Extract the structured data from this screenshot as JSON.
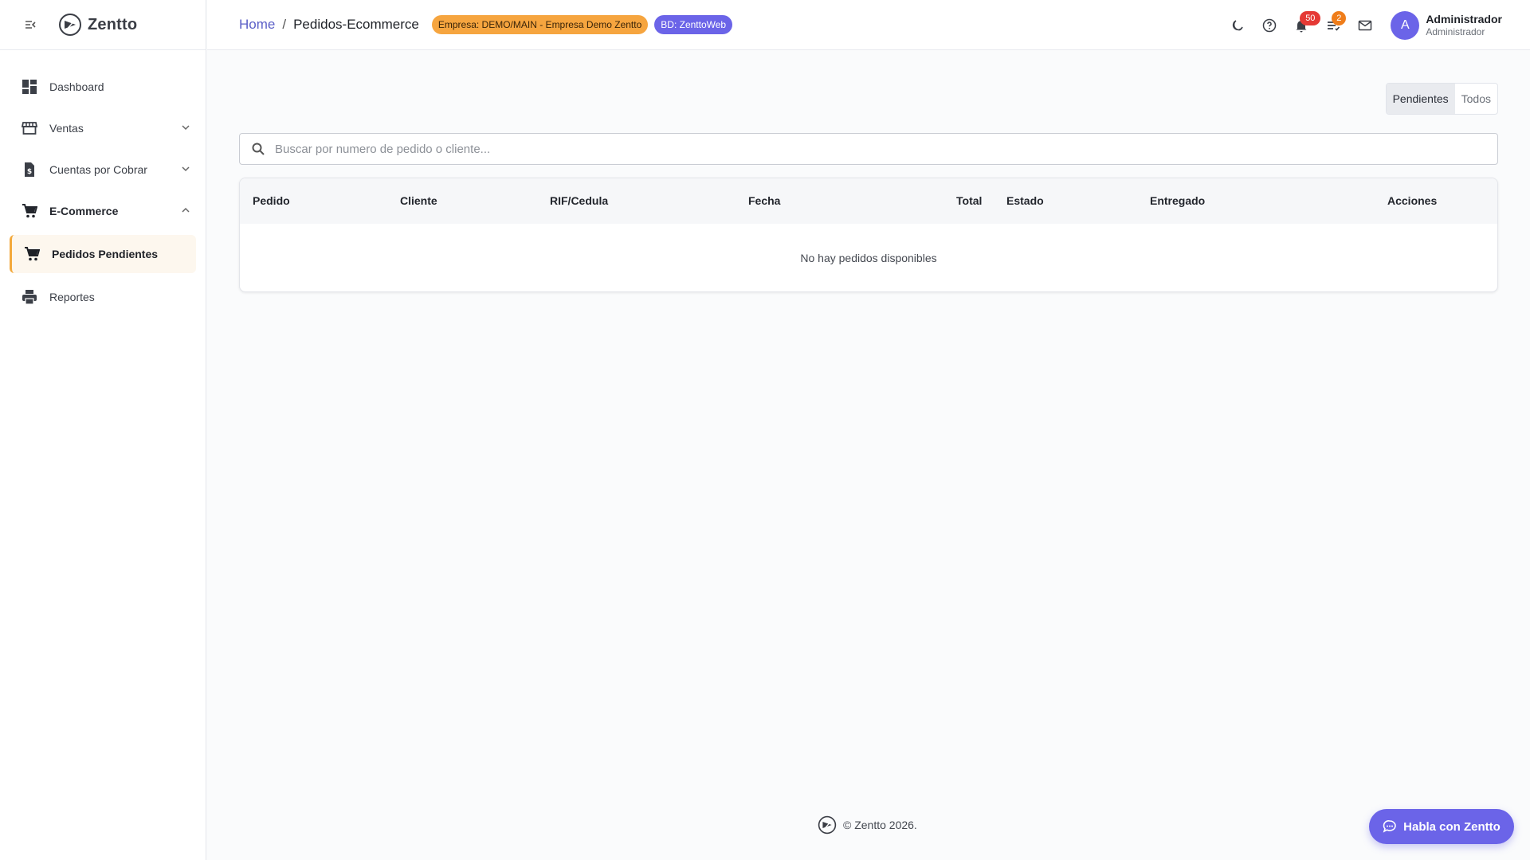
{
  "brand": {
    "name": "Zentto",
    "logo_icon": "zentto-logo-icon",
    "collapse_icon": "menu-collapse-icon"
  },
  "sidebar": {
    "items": [
      {
        "label": "Dashboard",
        "icon": "dashboard-icon"
      },
      {
        "label": "Ventas",
        "icon": "store-icon",
        "chevron": "chevron-down"
      },
      {
        "label": "Cuentas por Cobrar",
        "icon": "invoice-dollar-icon",
        "chevron": "chevron-down"
      },
      {
        "label": "E-Commerce",
        "icon": "cart-icon",
        "chevron": "chevron-up",
        "expanded": true
      },
      {
        "label": "Pedidos Pendientes",
        "icon": "cart-icon",
        "active": true
      },
      {
        "label": "Reportes",
        "icon": "printer-icon"
      }
    ]
  },
  "header": {
    "breadcrumb": {
      "home": "Home",
      "separator": "/",
      "current": "Pedidos-Ecommerce"
    },
    "empresa_chip": "Empresa: DEMO/MAIN - Empresa Demo Zentto",
    "bd_chip": "BD: ZenttoWeb",
    "notifications_count": "50",
    "tasks_count": "2",
    "user": {
      "initial": "A",
      "name": "Administrador",
      "role": "Administrador"
    }
  },
  "main": {
    "filter_toggle": {
      "options": [
        "Pendientes",
        "Todos"
      ],
      "selected": "Pendientes"
    },
    "search": {
      "placeholder": "Buscar por numero de pedido o cliente...",
      "value": ""
    },
    "table": {
      "columns": [
        "Pedido",
        "Cliente",
        "RIF/Cedula",
        "Fecha",
        "Total",
        "Estado",
        "Entregado",
        "Acciones"
      ],
      "rows": [],
      "empty_message": "No hay pedidos disponibles"
    }
  },
  "footer": {
    "text": "© Zentto 2026."
  },
  "chat_button": {
    "label": "Habla con Zentto"
  },
  "colors": {
    "accent": "#6b64e8",
    "warning": "#f6a53f",
    "danger": "#e53935",
    "active_border": "#f3a93c"
  }
}
